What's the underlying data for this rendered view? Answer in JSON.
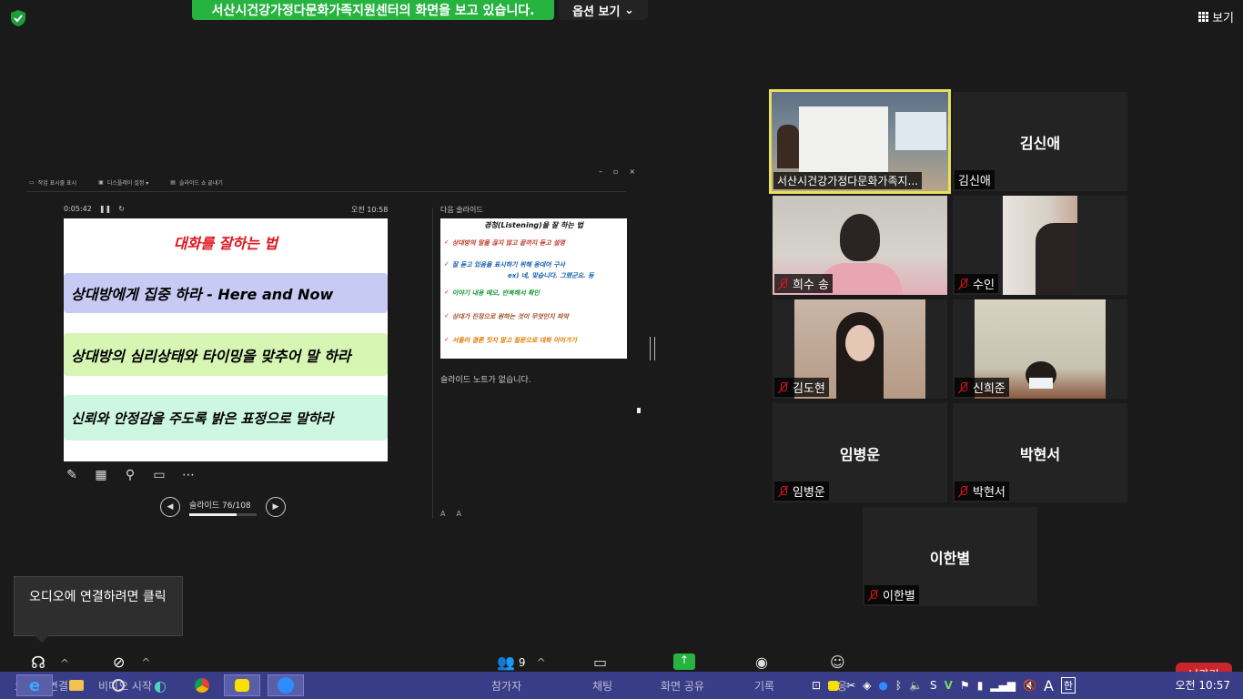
{
  "topbar": {
    "share_banner": "서산시건강가정다문화가족지원센터의 화면을 보고 있습니다.",
    "view_options": "옵션 보기",
    "view_button": "보기"
  },
  "presenter": {
    "toolbar": [
      "작업 표시줄 표시",
      "디스플레이 설정 ▾",
      "슬라이드 쇼 끝내기"
    ],
    "window_controls": [
      "–",
      "▫",
      "×"
    ],
    "timer": "0:05:42",
    "clock": "오전 10:58",
    "current_slide": {
      "title": "대화를 잘하는 법",
      "items": [
        "상대방에게 집중 하라 - Here and Now",
        "상대방의 심리상태와 타이밍을 맞추어 말 하라",
        "신뢰와 안정감을 주도록 밝은 표정으로 말하라"
      ]
    },
    "slide_counter": "슬라이드 76/108",
    "slide_progress": 0.7,
    "next_slide_label": "다음 슬라이드",
    "next_slide": {
      "title": "경청(Listening)을 잘 하는 법",
      "items": [
        {
          "text": "상대방의 말을 끊지 않고 끝까지 듣고 설명",
          "color": "#c0392b"
        },
        {
          "text": "잘 듣고 있음을 표시하기 위해 응대어 구사",
          "color": "#1560b0"
        },
        {
          "text": "이야기 내용 메모, 반복해서 확인",
          "color": "#1a9c3a"
        },
        {
          "text": "상대가 진정으로 원하는 것이 무엇인지 파악",
          "color": "#a0522d"
        },
        {
          "text": "서둘러 결론 짓지 말고 질문으로 대화 이어가기",
          "color": "#e07b00"
        }
      ],
      "sub": "ex) 네, 맞습니다. 그랬군요. 등"
    },
    "notes": "슬라이드 노트가 없습니다.",
    "font_controls": [
      "A",
      "A"
    ]
  },
  "participants": [
    {
      "name": "서산시건강가정다문화가족지...",
      "video": true,
      "active": true,
      "muted": false
    },
    {
      "name": "김신애",
      "video": false,
      "muted": false
    },
    {
      "name": "희수 송",
      "video": true,
      "muted": true
    },
    {
      "name": "수인",
      "video": true,
      "muted": true
    },
    {
      "name": "김도현",
      "video": true,
      "muted": true
    },
    {
      "name": "신희준",
      "video": true,
      "muted": true
    },
    {
      "name": "임병운",
      "video": false,
      "muted": true
    },
    {
      "name": "박현서",
      "video": false,
      "muted": true
    },
    {
      "name": "이한별",
      "video": false,
      "muted": true
    }
  ],
  "tooltip": "오디오에 연결하려면 클릭",
  "zoom_bar": {
    "participants_count": "9",
    "labels": [
      "오디오 연결",
      "비디오 시작",
      "참가자",
      "채팅",
      "화면 공유",
      "기록",
      "반응"
    ],
    "leave": "나가기"
  },
  "taskbar": {
    "clock": "오전 10:57",
    "ime": "한",
    "lang": "A"
  },
  "colors": {
    "share_green": "#26b340",
    "active_border": "#e8e05a",
    "leave_red": "#c8262d",
    "taskbar": "#3a3d8a"
  }
}
